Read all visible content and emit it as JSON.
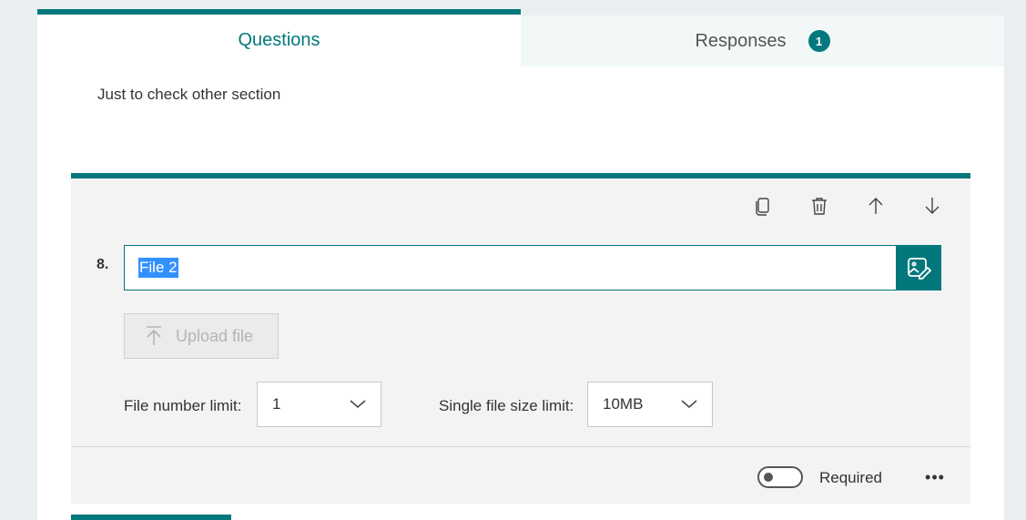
{
  "tabs": {
    "questions_label": "Questions",
    "responses_label": "Responses",
    "responses_count": "1"
  },
  "section": {
    "description": "Just to check other section"
  },
  "question": {
    "number": "8.",
    "title": "File 2",
    "upload_label": "Upload file",
    "file_number_limit_label": "File number limit:",
    "file_number_limit_value": "1",
    "file_size_limit_label": "Single file size limit:",
    "file_size_limit_value": "10MB",
    "required_label": "Required",
    "required_on": false,
    "more_label": "•••"
  },
  "icons": {
    "copy": "copy-icon",
    "delete": "trash-icon",
    "move_up": "arrow-up-icon",
    "move_down": "arrow-down-icon",
    "image": "image-edit-icon",
    "upload": "upload-icon",
    "dropdown": "chevron-down-icon"
  },
  "colors": {
    "accent": "#03787c",
    "selection": "#3390ff"
  }
}
